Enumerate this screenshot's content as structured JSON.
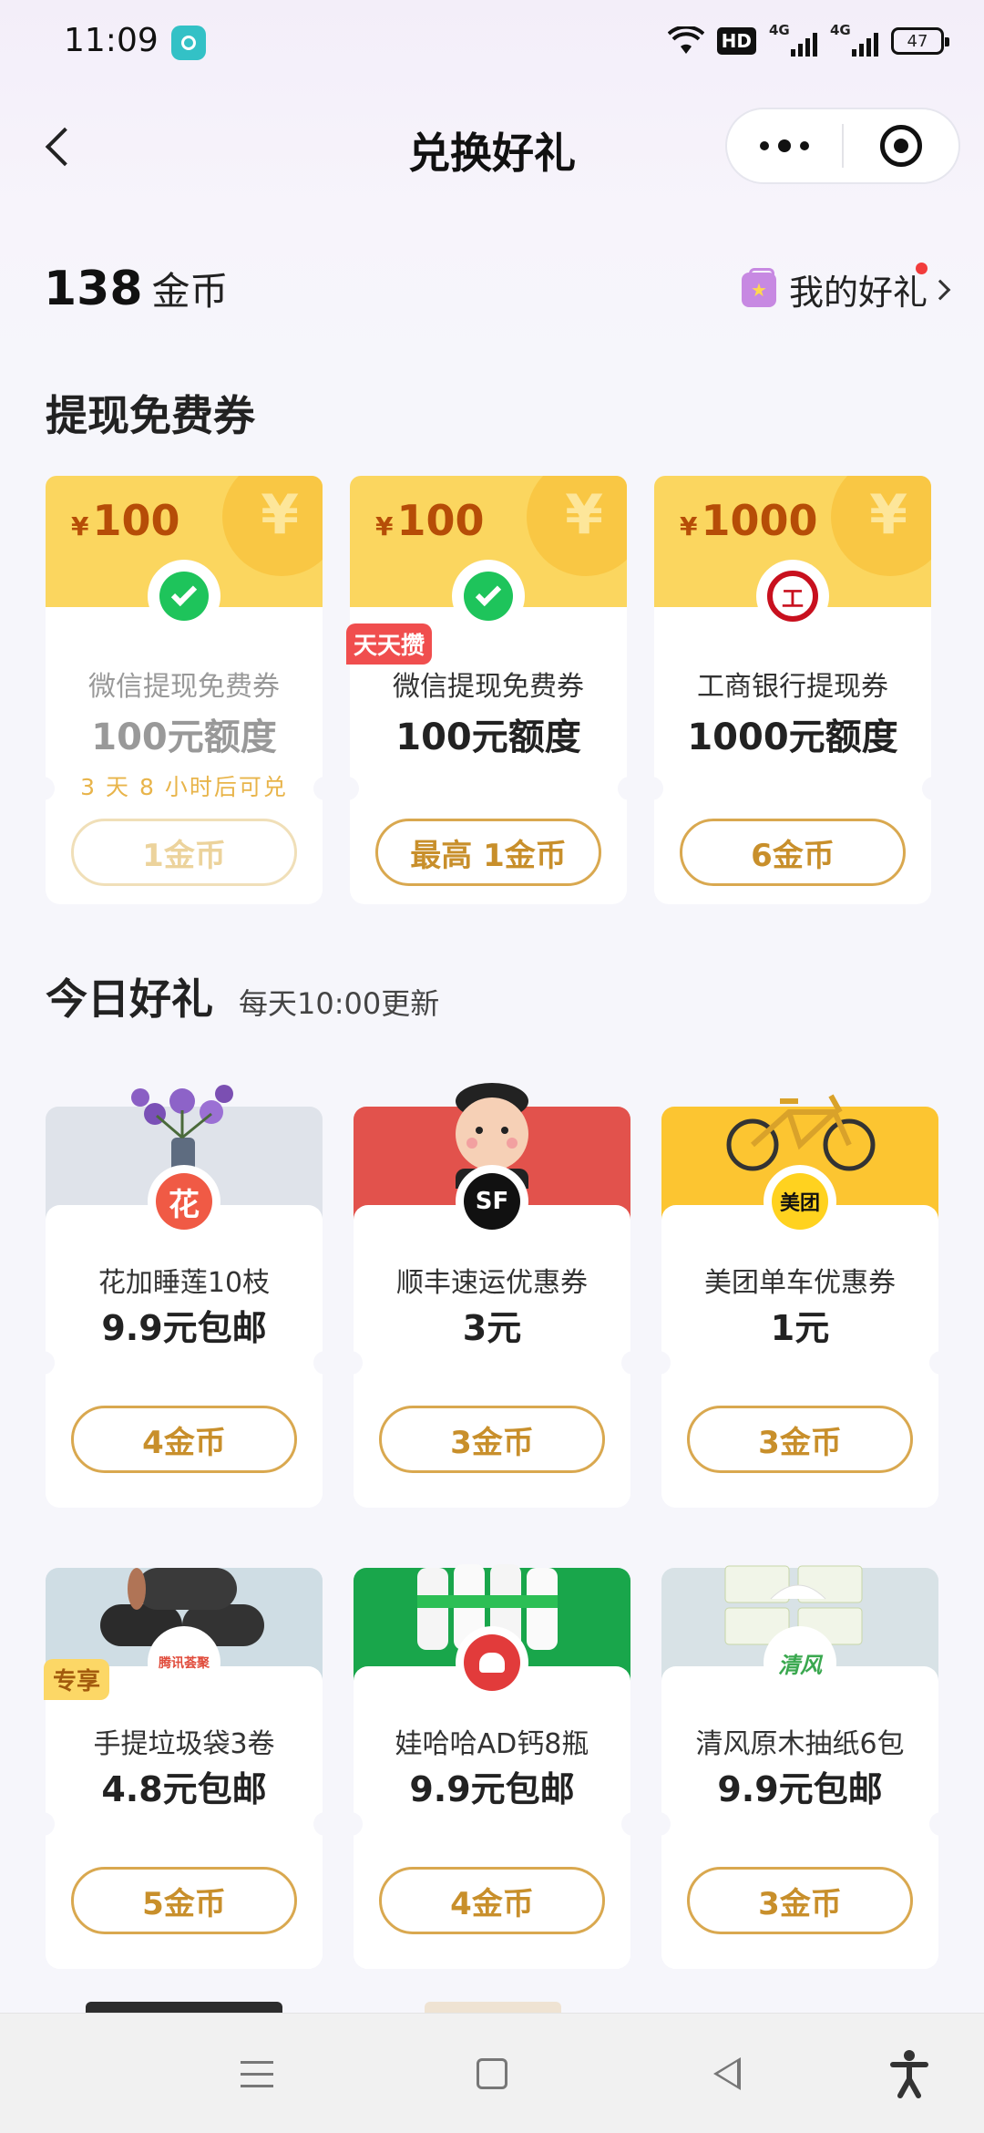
{
  "status_bar": {
    "time": "11:09",
    "hd": "HD",
    "sig1": "4G",
    "sig2": "4G",
    "battery": "47"
  },
  "nav": {
    "title": "兑换好礼"
  },
  "header": {
    "coins_value": "138",
    "coins_unit": "金币",
    "my_gifts_label": "我的好礼"
  },
  "withdraw_section": {
    "title": "提现免费券",
    "cards": [
      {
        "amount": "100",
        "currency": "¥",
        "name": "微信提现免费券",
        "quota": "100元额度",
        "note": "3 天 8 小时后可兑",
        "button": "1金币",
        "icon": "wechat-icon",
        "disabled": true
      },
      {
        "amount": "100",
        "currency": "¥",
        "name": "微信提现免费券",
        "quota": "100元额度",
        "tag": "天天攒",
        "button": "最高 1金币",
        "icon": "wechat-icon"
      },
      {
        "amount": "1000",
        "currency": "¥",
        "name": "工商银行提现券",
        "quota": "1000元额度",
        "button": "6金币",
        "icon": "icbc-icon"
      }
    ]
  },
  "gifts_section": {
    "title": "今日好礼",
    "subtitle": "每天10:00更新",
    "items": [
      {
        "name": "花加睡莲10枝",
        "price": "9.9元包邮",
        "button": "4金币",
        "logo_text": "花",
        "icon": "flower-icon"
      },
      {
        "name": "顺丰速运优惠券",
        "price": "3元",
        "button": "3金币",
        "logo_text": "SF",
        "icon": "sf-express-icon"
      },
      {
        "name": "美团单车优惠券",
        "price": "1元",
        "button": "3金币",
        "logo_text": "美团",
        "icon": "meituan-icon"
      },
      {
        "name": "手提垃圾袋3卷",
        "price": "4.8元包邮",
        "button": "5金币",
        "logo_text": "腾讯荟聚",
        "tag": "专享",
        "icon": "tencent-icon"
      },
      {
        "name": "娃哈哈AD钙8瓶",
        "price": "9.9元包邮",
        "button": "4金币",
        "logo_text": "",
        "icon": "jd-icon"
      },
      {
        "name": "清风原木抽纸6包",
        "price": "9.9元包邮",
        "button": "3金币",
        "logo_text": "清风",
        "icon": "qingfeng-icon"
      }
    ]
  },
  "colors": {
    "gold": "#d9a84f",
    "voucher_yellow": "#fbd65f",
    "red": "#f04e4e"
  }
}
